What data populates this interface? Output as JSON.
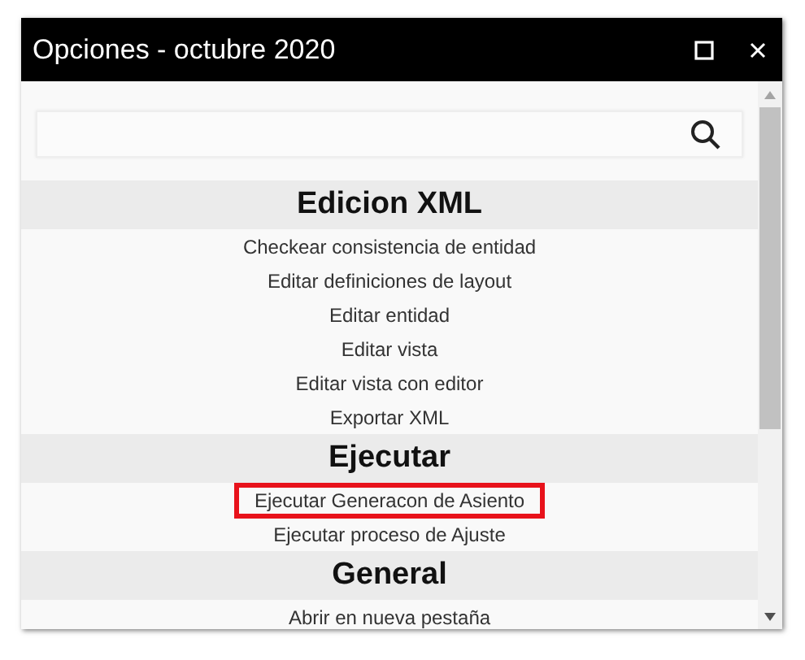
{
  "window": {
    "title": "Opciones - octubre 2020"
  },
  "sections": [
    {
      "title": "Edicion XML",
      "items": [
        {
          "label": "Checkear consistencia de entidad",
          "highlighted": false
        },
        {
          "label": "Editar definiciones de layout",
          "highlighted": false
        },
        {
          "label": "Editar entidad",
          "highlighted": false
        },
        {
          "label": "Editar vista",
          "highlighted": false
        },
        {
          "label": "Editar vista con editor",
          "highlighted": false
        },
        {
          "label": "Exportar XML",
          "highlighted": false
        }
      ]
    },
    {
      "title": "Ejecutar",
      "items": [
        {
          "label": "Ejecutar Generacon de Asiento",
          "highlighted": true
        },
        {
          "label": "Ejecutar proceso de Ajuste",
          "highlighted": false
        }
      ]
    },
    {
      "title": "General",
      "items": [
        {
          "label": "Abrir en nueva pestaña",
          "highlighted": false
        }
      ]
    }
  ]
}
